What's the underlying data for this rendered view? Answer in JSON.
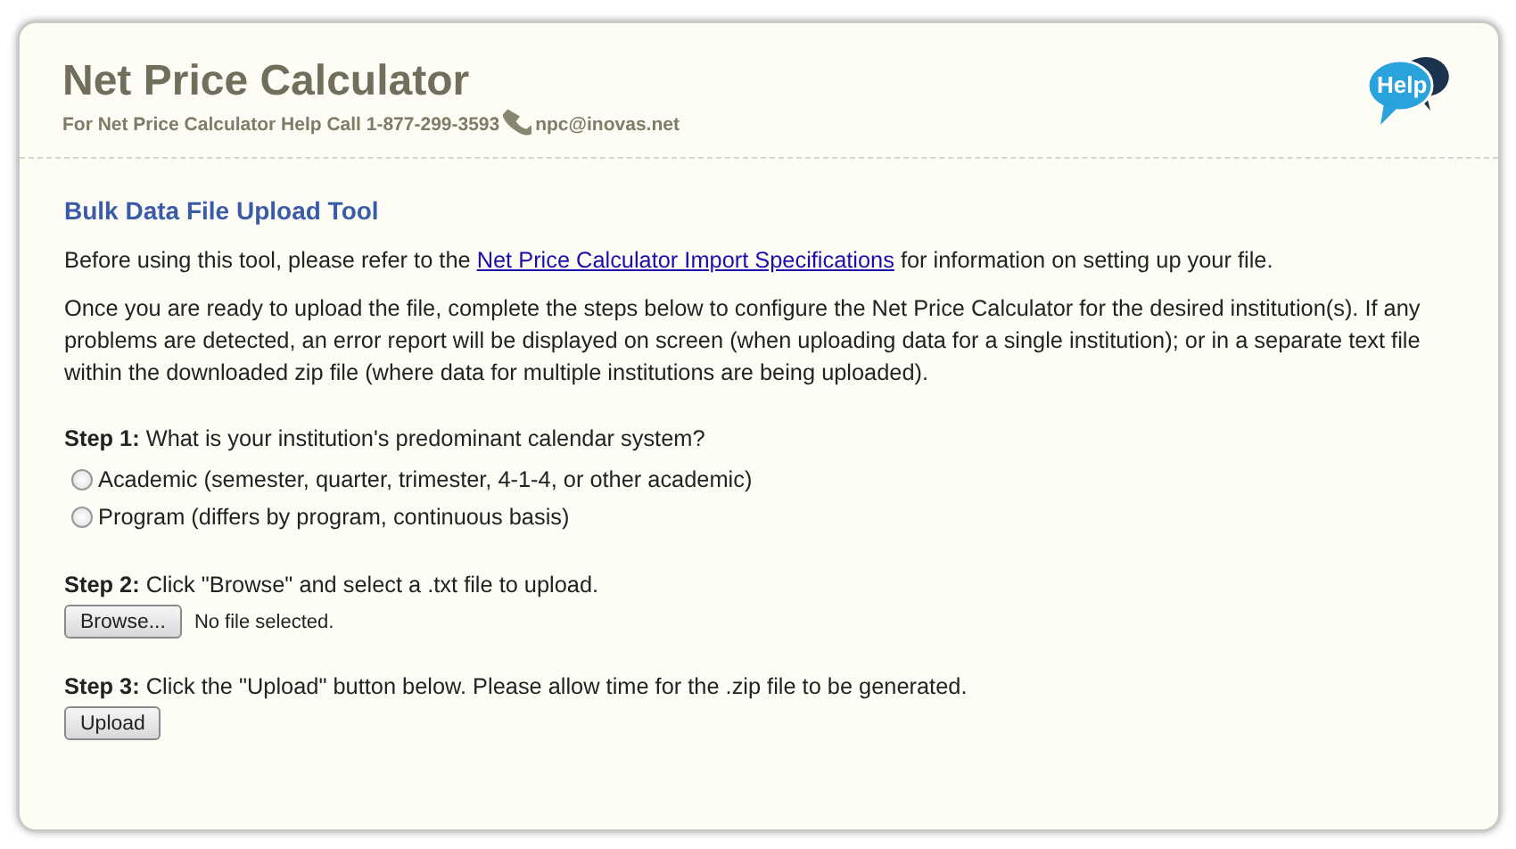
{
  "header": {
    "title": "Net Price Calculator",
    "help_line": "For Net Price Calculator Help Call 1-877-299-3593",
    "email": "npc@inovas.net",
    "help_badge": "Help"
  },
  "page_title": "Bulk Data File Upload Tool",
  "intro": {
    "before": "Before using this tool, please refer to the ",
    "link": "Net Price Calculator Import Specifications",
    "after": " for information on setting up your file."
  },
  "instructions": "Once you are ready to upload the file, complete the steps below to configure the Net Price Calculator for the desired institution(s). If any problems are detected, an error report will be displayed on screen (when uploading data for a single institution); or in a separate text file within the downloaded zip file (where data for multiple institutions are being uploaded).",
  "step1": {
    "label": "**Step 1:** What is your institution's predominant calendar system?",
    "options": [
      {
        "label": "Academic (semester, quarter, trimester, 4-1-4, or other academic)",
        "selected": false
      },
      {
        "label": "Program (differs by program, continuous basis)",
        "selected": false
      }
    ]
  },
  "step2": {
    "label": "**Step 2:** Click \"Browse\" and select a .txt file to upload.",
    "button": "Browse...",
    "file_status": "No file selected."
  },
  "step3": {
    "label": "**Step 3:** Click the \"Upload\" button below. Please allow time for the .zip file to be generated.",
    "button": "Upload"
  }
}
